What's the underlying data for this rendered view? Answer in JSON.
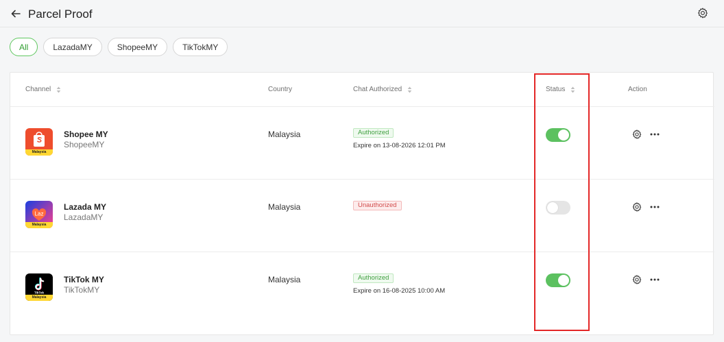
{
  "header": {
    "title": "Parcel Proof"
  },
  "filters": [
    "All",
    "LazadaMY",
    "ShopeeMY",
    "TikTokMY"
  ],
  "table": {
    "columns": {
      "channel": "Channel",
      "country": "Country",
      "chat": "Chat Authorized",
      "status": "Status",
      "action": "Action"
    },
    "rows": [
      {
        "name": "Shopee MY",
        "sub": "ShopeeMY",
        "country": "Malaysia",
        "auth": "Authorized",
        "expire": "Expire on 13-08-2026 12:01 PM",
        "enabled": true,
        "strip": "Malaysia"
      },
      {
        "name": "Lazada MY",
        "sub": "LazadaMY",
        "country": "Malaysia",
        "auth": "Unauthorized",
        "expire": "",
        "enabled": false,
        "logo_text": "Laz",
        "strip": "Malaysia"
      },
      {
        "name": "TikTok MY",
        "sub": "TikTokMY",
        "country": "Malaysia",
        "auth": "Authorized",
        "expire": "Expire on 16-08-2025 10:00 AM",
        "enabled": true,
        "logo_text": "TikTok",
        "strip": "Malaysia"
      }
    ]
  },
  "colors": {
    "accent": "#5cc160",
    "highlight": "#e32626"
  },
  "icons": {
    "back": "arrow-left-icon",
    "settings": "gear-icon",
    "more": "ellipsis-icon",
    "sort": "sort-icon"
  }
}
